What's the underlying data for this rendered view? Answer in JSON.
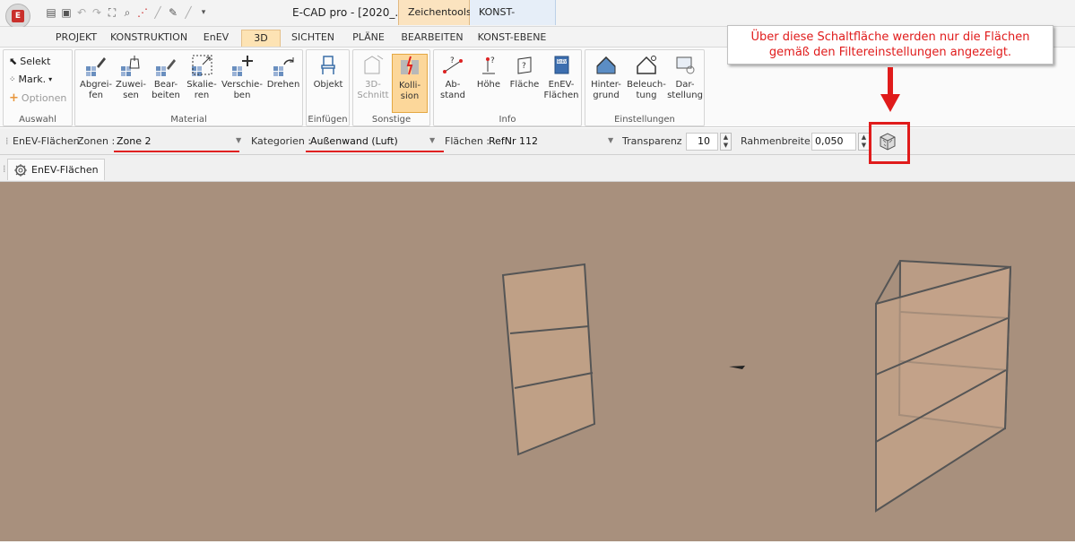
{
  "title": {
    "app_title": "E-CAD pro - [2020_...",
    "context_tab_zeichentools": "Zeichentools",
    "context_tab_konst": "KONST-EBENE"
  },
  "tabs": [
    "PROJEKT",
    "KONSTRUKTION",
    "EnEV",
    "3D",
    "SICHTEN",
    "PLÄNE",
    "BEARBEITEN",
    "KONST-EBENE"
  ],
  "ribbon": {
    "auswahl": {
      "label": "Auswahl",
      "selekt": "Selekt",
      "mark": "Mark.",
      "optionen": "Optionen"
    },
    "material": {
      "label": "Material",
      "buttons": [
        {
          "l1": "Abgrei-",
          "l2": "fen"
        },
        {
          "l1": "Zuwei-",
          "l2": "sen"
        },
        {
          "l1": "Bear-",
          "l2": "beiten"
        },
        {
          "l1": "Skalie-",
          "l2": "ren"
        },
        {
          "l1": "Verschie-",
          "l2": "ben"
        },
        {
          "l1": "Drehen",
          "l2": ""
        }
      ]
    },
    "einfuegen": {
      "label": "Einfügen",
      "objekt": "Objekt"
    },
    "sonstige": {
      "label": "Sonstige",
      "schnitt_l1": "3D-",
      "schnitt_l2": "Schnitt",
      "kollision_l1": "Kolli-",
      "kollision_l2": "sion"
    },
    "info": {
      "label": "Info",
      "buttons": [
        {
          "l1": "Ab-",
          "l2": "stand"
        },
        {
          "l1": "Höhe",
          "l2": ""
        },
        {
          "l1": "Fläche",
          "l2": ""
        },
        {
          "l1": "EnEV-",
          "l2": "Flächen"
        }
      ]
    },
    "einstellungen": {
      "label": "Einstellungen",
      "buttons": [
        {
          "l1": "Hinter-",
          "l2": "grund"
        },
        {
          "l1": "Beleuch-",
          "l2": "tung"
        },
        {
          "l1": "Dar-",
          "l2": "stellung"
        }
      ]
    }
  },
  "toolbar": {
    "title": "EnEV-Flächen",
    "zonen_label": "Zonen :",
    "zonen_value": "Zone 2",
    "kategorien_label": "Kategorien :",
    "kategorien_value": "Außenwand (Luft)",
    "flaechen_label": "Flächen :",
    "flaechen_value": "RefNr  112",
    "transparenz_label": "Transparenz :",
    "transparenz_value": "10",
    "rahmenbreite_label": "Rahmenbreite :",
    "rahmenbreite_value": "0,050"
  },
  "panel_tab": "EnEV-Flächen",
  "callout": {
    "line1": "Über diese Schaltfläche werden nur die Flächen",
    "line2": "gemäß den Filtereinstellungen angezeigt."
  },
  "colors": {
    "viewport_bg": "#a8907d",
    "surface_fill": "#c7a58a",
    "annotation_red": "#e01b1b",
    "active_tab": "#fde3b4"
  }
}
